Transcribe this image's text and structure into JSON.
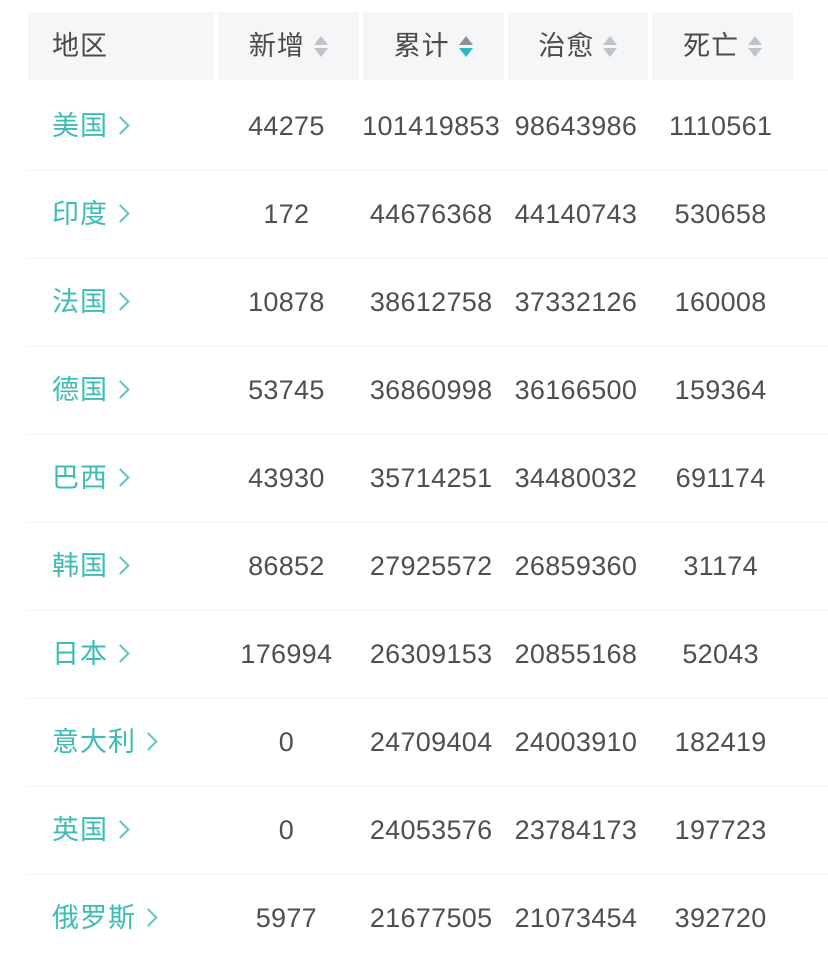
{
  "table": {
    "columns": [
      {
        "key": "region",
        "label": "地区",
        "sortable": false,
        "align": "left"
      },
      {
        "key": "new",
        "label": "新增",
        "sortable": true,
        "sort": "none",
        "align": "center"
      },
      {
        "key": "total",
        "label": "累计",
        "sortable": true,
        "sort": "desc",
        "align": "center"
      },
      {
        "key": "cured",
        "label": "治愈",
        "sortable": true,
        "sort": "none",
        "align": "center"
      },
      {
        "key": "dead",
        "label": "死亡",
        "sortable": true,
        "sort": "none",
        "align": "center"
      }
    ],
    "sorter_icon": "sort-updown-icon",
    "chevron_icon": "chevron-right-icon",
    "colors": {
      "accent_teal": "#3cbcb4",
      "sort_active": "#2fb8bf",
      "sort_inactive": "#bfc2c6",
      "header_bg": "#f5f6f7",
      "value_text": "#4f4f4f",
      "row_divider": "#f2f3f5"
    },
    "rows": [
      {
        "region": "美国",
        "new": "44275",
        "total": "101419853",
        "cured": "98643986",
        "dead": "1110561"
      },
      {
        "region": "印度",
        "new": "172",
        "total": "44676368",
        "cured": "44140743",
        "dead": "530658"
      },
      {
        "region": "法国",
        "new": "10878",
        "total": "38612758",
        "cured": "37332126",
        "dead": "160008"
      },
      {
        "region": "德国",
        "new": "53745",
        "total": "36860998",
        "cured": "36166500",
        "dead": "159364"
      },
      {
        "region": "巴西",
        "new": "43930",
        "total": "35714251",
        "cured": "34480032",
        "dead": "691174"
      },
      {
        "region": "韩国",
        "new": "86852",
        "total": "27925572",
        "cured": "26859360",
        "dead": "31174"
      },
      {
        "region": "日本",
        "new": "176994",
        "total": "26309153",
        "cured": "20855168",
        "dead": "52043"
      },
      {
        "region": "意大利",
        "new": "0",
        "total": "24709404",
        "cured": "24003910",
        "dead": "182419"
      },
      {
        "region": "英国",
        "new": "0",
        "total": "24053576",
        "cured": "23784173",
        "dead": "197723"
      },
      {
        "region": "俄罗斯",
        "new": "5977",
        "total": "21677505",
        "cured": "21073454",
        "dead": "392720"
      }
    ]
  }
}
